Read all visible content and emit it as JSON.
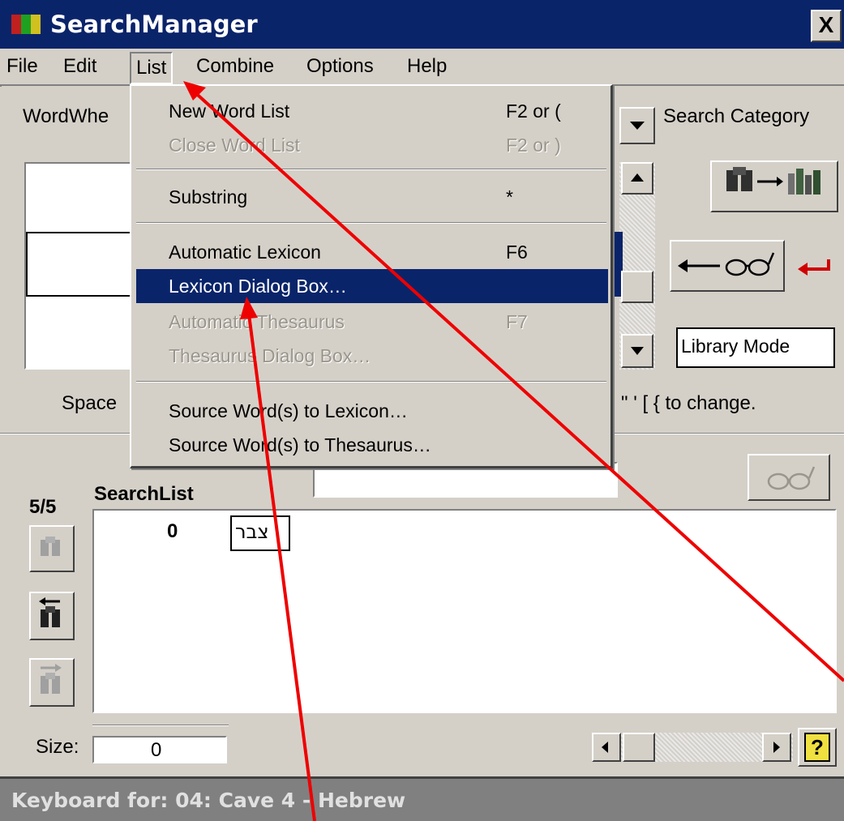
{
  "window": {
    "title": "SearchManager",
    "close_label": "X"
  },
  "menubar": {
    "items": [
      "File",
      "Edit",
      "List",
      "Combine",
      "Options",
      "Help"
    ],
    "open_menu": "List"
  },
  "top_panel": {
    "wordwheel_label": "WordWhe",
    "search_category_label": "Search Category",
    "library_mode_value": "Library Mode",
    "space_hint": "Space",
    "change_hint": "\" ' [ { to change."
  },
  "list_menu": {
    "items": [
      {
        "label": "New Word List",
        "shortcut": "F2 or (",
        "enabled": true
      },
      {
        "label": "Close Word List",
        "shortcut": "F2 or )",
        "enabled": false
      },
      {
        "label": "Substring",
        "shortcut": "*",
        "enabled": true
      },
      {
        "label": "Automatic Lexicon",
        "shortcut": "F6",
        "enabled": true
      },
      {
        "label": "Lexicon Dialog Box…",
        "shortcut": "",
        "enabled": true,
        "highlighted": true
      },
      {
        "label": "Automatic Thesaurus",
        "shortcut": "F7",
        "enabled": false
      },
      {
        "label": "Thesaurus Dialog Box…",
        "shortcut": "",
        "enabled": false
      },
      {
        "label": "Source Word(s) to Lexicon…",
        "shortcut": "",
        "enabled": true
      },
      {
        "label": "Source Word(s) to Thesaurus…",
        "shortcut": "",
        "enabled": true
      }
    ]
  },
  "search_list": {
    "count_label": "5/5",
    "title": "SearchList",
    "row_index": "0",
    "row_word": "צבר",
    "size_label": "Size:",
    "size_value": "0",
    "help_glyph": "?"
  },
  "statusbar": {
    "text": "Keyboard for: 04: Cave 4 - Hebrew"
  },
  "colors": {
    "titlebar": "#0a246a",
    "menu_highlight": "#0a246a",
    "face": "#d4d0c8",
    "annotation_arrow": "#ee0000"
  },
  "icons": [
    "binoculars-to-books-icon",
    "arrow-to-glasses-icon",
    "return-arrow-icon",
    "glasses-icon",
    "binoculars-icon",
    "help-icon"
  ]
}
